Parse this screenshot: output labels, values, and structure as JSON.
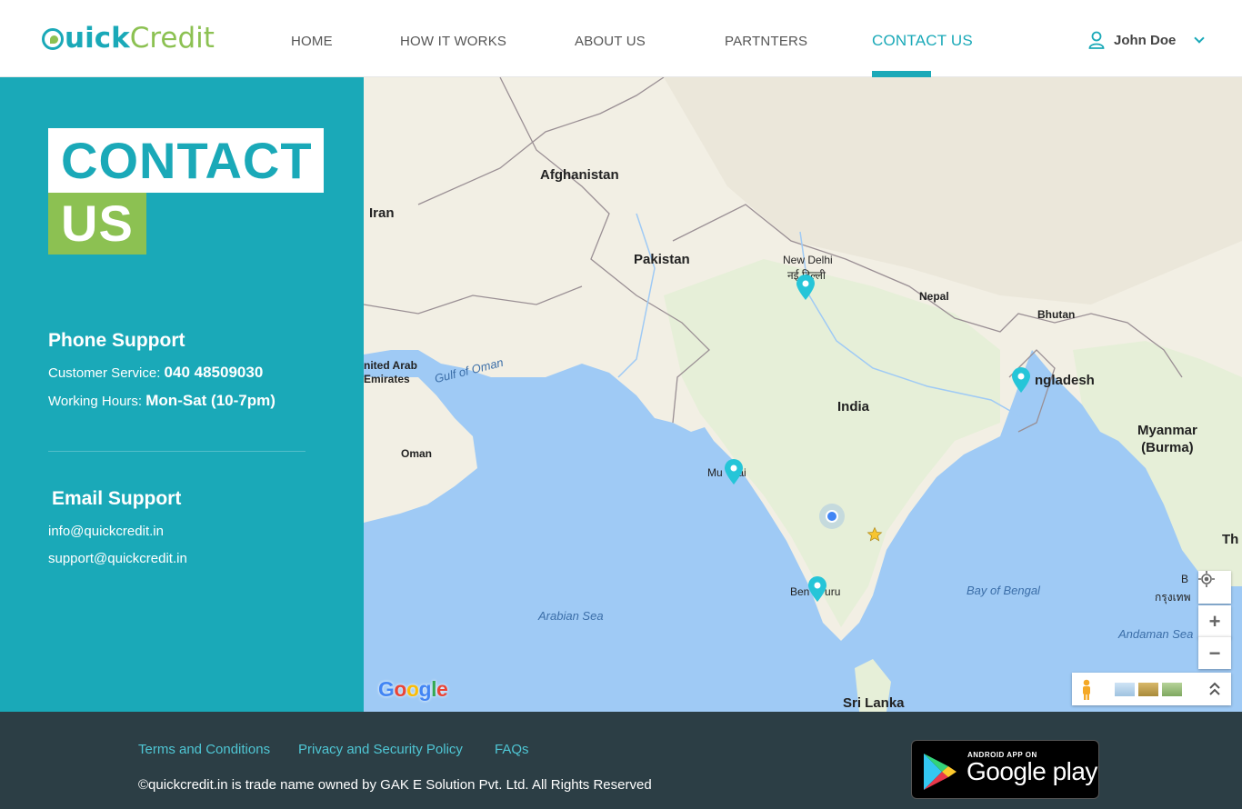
{
  "brand": {
    "logo_q": "uick",
    "logo_c": "Credit",
    "colors": {
      "teal": "#1aa9b8",
      "green": "#8cc152",
      "footer": "#2c3e45"
    }
  },
  "nav": {
    "items": [
      {
        "label": "HOME",
        "active": false
      },
      {
        "label": "HOW IT WORKS",
        "active": false
      },
      {
        "label": "ABOUT US",
        "active": false
      },
      {
        "label": "PARTNTERS",
        "active": false
      },
      {
        "label": "CONTACT US",
        "active": true
      }
    ],
    "user_name": "John Doe",
    "user_icon": "user-icon",
    "dropdown_icon": "chevron-down-icon"
  },
  "contact": {
    "title_line1": "CONTACT",
    "title_line2": "US",
    "phone_heading": "Phone Support",
    "customer_service_label": "Customer Service:",
    "customer_service_value": "040 48509030",
    "hours_label": "Working Hours:",
    "hours_value": "Mon-Sat (10-7pm)",
    "email_heading": "Email Support",
    "emails": [
      "info@quickcredit.in",
      "support@quickcredit.in"
    ]
  },
  "map": {
    "labels": {
      "afghanistan": "Afghanistan",
      "iran": "Iran",
      "pakistan": "Pakistan",
      "new_delhi": "New Delhi",
      "new_delhi_local": "नई दिल्ली",
      "nepal": "Nepal",
      "bhutan": "Bhutan",
      "bangladesh": "ngladesh",
      "uae": "nited Arab\nEmirates",
      "gulf_of_oman": "Gulf of Oman",
      "india": "India",
      "myanmar": "Myanmar\n(Burma)",
      "oman": "Oman",
      "mumbai": "Mu     ai",
      "bengaluru": "Ben     uru",
      "bay_of_bengal": "Bay of Bengal",
      "arabian_sea": "Arabian Sea",
      "andaman_sea": "Andaman Sea",
      "sri_lanka": "Sri Lanka",
      "th": "Th",
      "bangkok": "B     k",
      "bangkok_local": "กรุงเทพ",
      "google": "Google"
    },
    "controls": {
      "zoom_in": "+",
      "zoom_out": "−",
      "locate_icon": "crosshair-icon",
      "pegman_icon": "pegman-icon",
      "expand_icon": "double-chevron-up-icon"
    },
    "pins": [
      "pin-icon",
      "pin-icon",
      "pin-icon",
      "pin-icon"
    ]
  },
  "footer": {
    "links": [
      "Terms and Conditions",
      "Privacy and Security Policy",
      "FAQs"
    ],
    "copyright": "©quickcredit.in is trade name owned by GAK E Solution Pvt. Ltd. All Rights Reserved",
    "store_small": "ANDROID APP ON",
    "store_big": "Google play"
  }
}
